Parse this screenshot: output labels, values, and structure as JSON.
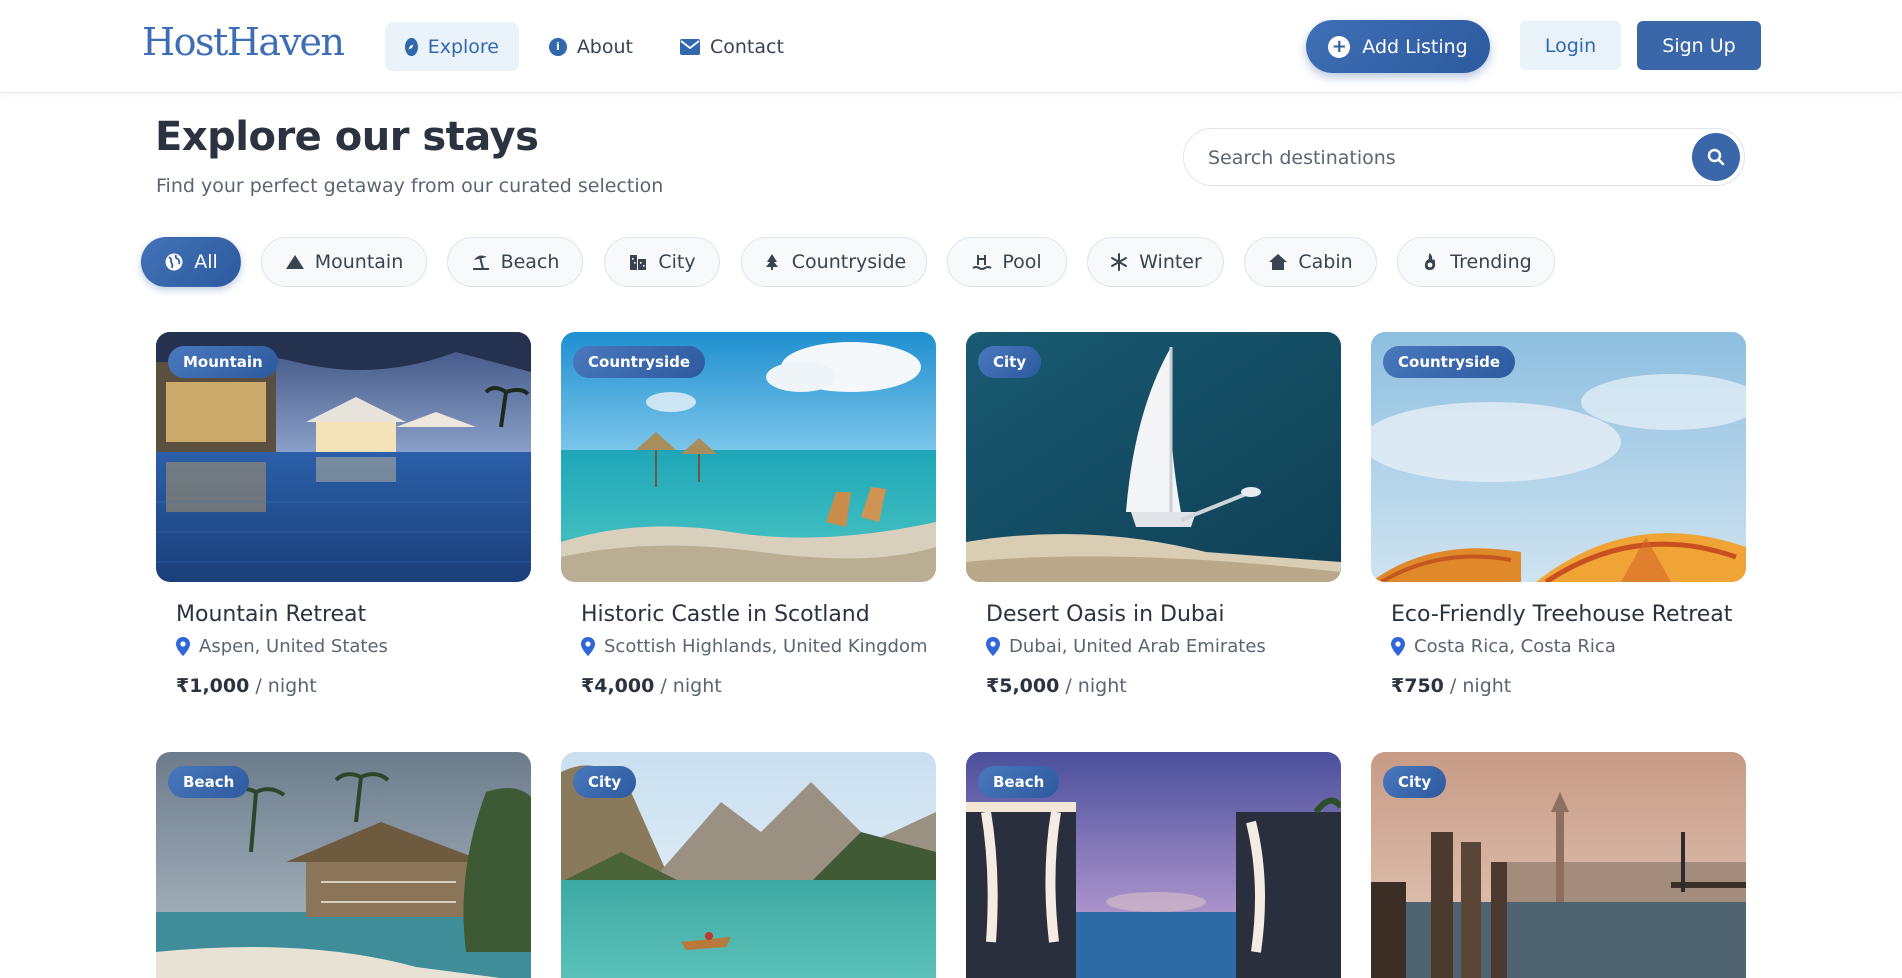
{
  "brand": {
    "logo": "HostHaven",
    "accent": "#3a67aa"
  },
  "nav": {
    "links": [
      {
        "label": "Explore",
        "icon": "compass-icon",
        "active": true
      },
      {
        "label": "About",
        "icon": "info-icon",
        "active": false
      },
      {
        "label": "Contact",
        "icon": "envelope-icon",
        "active": false
      }
    ],
    "add_listing": "Add Listing",
    "login": "Login",
    "signup": "Sign Up"
  },
  "hero": {
    "title": "Explore our stays",
    "subtitle": "Find your perfect getaway from our curated selection"
  },
  "search": {
    "placeholder": "Search destinations"
  },
  "filters": [
    {
      "label": "All",
      "icon": "globe-icon",
      "active": true
    },
    {
      "label": "Mountain",
      "icon": "mountain-icon",
      "active": false
    },
    {
      "label": "Beach",
      "icon": "umbrella-beach-icon",
      "active": false
    },
    {
      "label": "City",
      "icon": "city-icon",
      "active": false
    },
    {
      "label": "Countryside",
      "icon": "tree-icon",
      "active": false
    },
    {
      "label": "Pool",
      "icon": "pool-icon",
      "active": false
    },
    {
      "label": "Winter",
      "icon": "snowflake-icon",
      "active": false
    },
    {
      "label": "Cabin",
      "icon": "house-icon",
      "active": false
    },
    {
      "label": "Trending",
      "icon": "fire-icon",
      "active": false
    }
  ],
  "listings": [
    {
      "category": "Mountain",
      "title": "Mountain Retreat",
      "location": "Aspen, United States",
      "price": "₹1,000",
      "per": " / night"
    },
    {
      "category": "Countryside",
      "title": "Historic Castle in Scotland",
      "location": "Scottish Highlands, United Kingdom",
      "price": "₹4,000",
      "per": " / night"
    },
    {
      "category": "City",
      "title": "Desert Oasis in Dubai",
      "location": "Dubai, United Arab Emirates",
      "price": "₹5,000",
      "per": " / night"
    },
    {
      "category": "Countryside",
      "title": "Eco-Friendly Treehouse Retreat",
      "location": "Costa Rica, Costa Rica",
      "price": "₹750",
      "per": " / night"
    },
    {
      "category": "Beach"
    },
    {
      "category": "City"
    },
    {
      "category": "Beach"
    },
    {
      "category": "City"
    }
  ]
}
